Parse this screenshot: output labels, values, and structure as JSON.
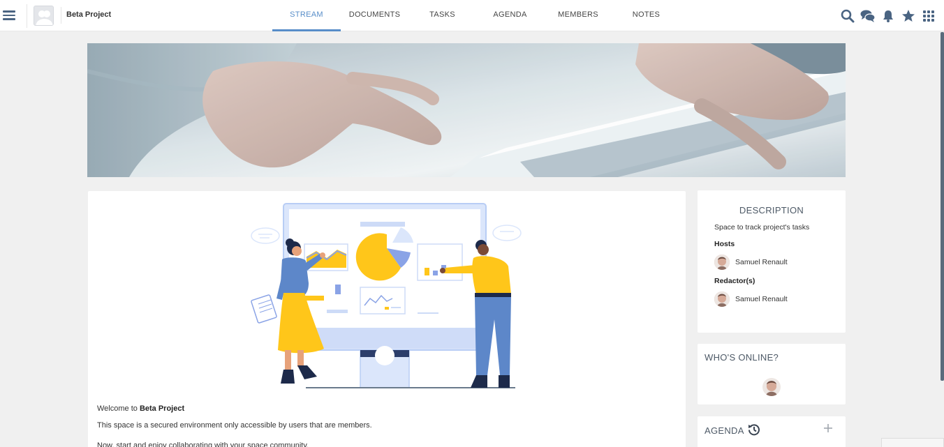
{
  "header": {
    "space_name": "Beta Project",
    "tabs": [
      {
        "label": "STREAM",
        "active": true
      },
      {
        "label": "DOCUMENTS",
        "active": false
      },
      {
        "label": "TASKS",
        "active": false
      },
      {
        "label": "AGENDA",
        "active": false
      },
      {
        "label": "MEMBERS",
        "active": false
      },
      {
        "label": "NOTES",
        "active": false
      }
    ],
    "icons": [
      "menu-icon",
      "search-icon",
      "chat-icon",
      "bell-icon",
      "star-icon",
      "apps-grid-icon"
    ],
    "accent_color": "#578dc9",
    "icon_color": "#4a6482"
  },
  "main": {
    "welcome_prefix": "Welcome to ",
    "welcome_space": "Beta Project",
    "paragraph1": "This space is a secured environment only accessible by users that are members.",
    "paragraph2": "Now, start and enjoy collaborating with your space community."
  },
  "description": {
    "title": "DESCRIPTION",
    "text": "Space to track project's tasks",
    "hosts_label": "Hosts",
    "hosts": [
      "Samuel Renault"
    ],
    "redactors_label": "Redactor(s)",
    "redactors": [
      "Samuel Renault"
    ]
  },
  "online": {
    "title": "WHO'S ONLINE?"
  },
  "agenda": {
    "title": "AGENDA"
  }
}
